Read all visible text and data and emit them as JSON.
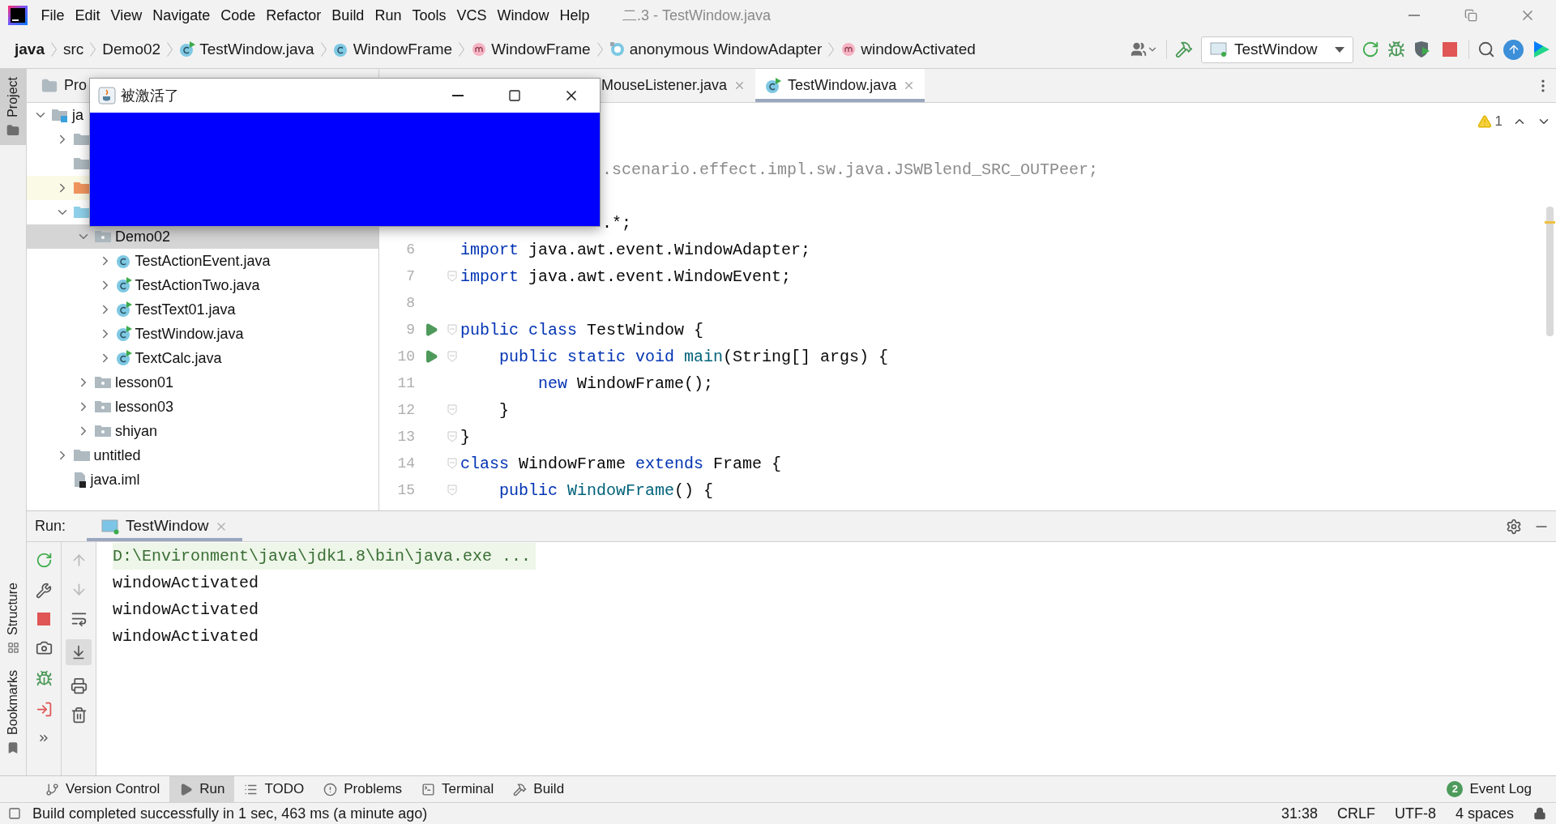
{
  "window": {
    "title": "二.3 - TestWindow.java"
  },
  "menu": [
    "File",
    "Edit",
    "View",
    "Navigate",
    "Code",
    "Refactor",
    "Build",
    "Run",
    "Tools",
    "VCS",
    "Window",
    "Help"
  ],
  "breadcrumbs": [
    {
      "label": "java",
      "kind": "module"
    },
    {
      "label": "src",
      "kind": "plain"
    },
    {
      "label": "Demo02",
      "kind": "plain"
    },
    {
      "label": "TestWindow.java",
      "kind": "runnable-class"
    },
    {
      "label": "WindowFrame",
      "kind": "class"
    },
    {
      "label": "WindowFrame",
      "kind": "method"
    },
    {
      "label": "anonymous WindowAdapter",
      "kind": "anonymous"
    },
    {
      "label": "windowActivated",
      "kind": "method"
    }
  ],
  "run_config": {
    "label": "TestWindow"
  },
  "popup": {
    "title": "被激活了"
  },
  "side_tabs": [
    {
      "label": "Project",
      "selected": true,
      "kind": "project"
    },
    {
      "label": "Structure",
      "selected": false,
      "kind": "structure"
    },
    {
      "label": "Bookmarks",
      "selected": false,
      "kind": "bookmarks"
    }
  ],
  "project_panel": {
    "title": "Pro",
    "tree": [
      {
        "label": "ja",
        "kind": "module",
        "expanded": true,
        "selected": false,
        "children": [
          {
            "kind": "folder",
            "expanded": false,
            "selected": false
          },
          {
            "kind": "folder",
            "selected": false
          },
          {
            "kind": "excluded",
            "expanded": false,
            "selected": false
          },
          {
            "kind": "source",
            "expanded": true,
            "selected": false,
            "children": [
              {
                "label": "Demo02",
                "kind": "package",
                "expanded": true,
                "selected": true,
                "children": [
                  {
                    "label": "TestActionEvent.java",
                    "kind": "class",
                    "expanded": false,
                    "selected": false
                  },
                  {
                    "label": "TestActionTwo.java",
                    "kind": "runnable-class",
                    "expanded": false,
                    "selected": false
                  },
                  {
                    "label": "TestText01.java",
                    "kind": "runnable-class",
                    "expanded": false,
                    "selected": false
                  },
                  {
                    "label": "TestWindow.java",
                    "kind": "runnable-class",
                    "expanded": false,
                    "selected": false
                  },
                  {
                    "label": "TextCalc.java",
                    "kind": "runnable-class",
                    "expanded": false,
                    "selected": false
                  }
                ]
              },
              {
                "label": "lesson01",
                "kind": "package",
                "expanded": false,
                "selected": false
              },
              {
                "label": "lesson03",
                "kind": "package",
                "expanded": false,
                "selected": false
              },
              {
                "label": "shiyan",
                "kind": "package",
                "expanded": false,
                "selected": false
              }
            ]
          },
          {
            "label": "untitled",
            "kind": "folder",
            "expanded": false,
            "selected": false
          },
          {
            "label": "java.iml",
            "kind": "file",
            "selected": false
          }
        ]
      }
    ]
  },
  "editor": {
    "tabs": [
      {
        "label": "MouseListener.java",
        "selected": false
      },
      {
        "label": "TestWindow.java",
        "selected": true
      }
    ],
    "warnings": "1",
    "lines": [
      {
        "kind": "partial",
        "tokens": [
          {
            "kind": "unused",
            "text": ".scenario.effect.impl.sw.java.JSWBlend_SRC_OUTPeer;"
          }
        ]
      },
      {
        "kind": "blank"
      },
      {
        "kind": "partial",
        "tokens": [
          {
            "kind": "plain",
            "text": ".*;"
          }
        ]
      },
      {
        "kind": "code",
        "number": "6",
        "run": false,
        "fold": false,
        "tokens": [
          {
            "kind": "keyword",
            "text": "import"
          },
          {
            "kind": "plain",
            "text": " java.awt.event.WindowAdapter;"
          }
        ]
      },
      {
        "kind": "code",
        "number": "7",
        "run": false,
        "fold": true,
        "tokens": [
          {
            "kind": "keyword",
            "text": "import"
          },
          {
            "kind": "plain",
            "text": " java.awt.event.WindowEvent;"
          }
        ]
      },
      {
        "kind": "code",
        "number": "8",
        "run": false,
        "fold": false
      },
      {
        "kind": "code",
        "number": "9",
        "run": true,
        "fold": true,
        "tokens": [
          {
            "kind": "keyword",
            "text": "public class"
          },
          {
            "kind": "plain",
            "text": " TestWindow {"
          }
        ]
      },
      {
        "kind": "code",
        "number": "10",
        "run": true,
        "fold": true,
        "tokens": [
          {
            "kind": "keyword",
            "text": "    public static void"
          },
          {
            "kind": "method",
            "text": " main"
          },
          {
            "kind": "plain",
            "text": "(String[] args) {"
          }
        ]
      },
      {
        "kind": "code",
        "number": "11",
        "run": false,
        "fold": false,
        "tokens": [
          {
            "kind": "keyword",
            "text": "        new"
          },
          {
            "kind": "plain",
            "text": " WindowFrame();"
          }
        ]
      },
      {
        "kind": "code",
        "number": "12",
        "run": false,
        "fold": true,
        "tokens": [
          {
            "kind": "plain",
            "text": "    }"
          }
        ]
      },
      {
        "kind": "code",
        "number": "13",
        "run": false,
        "fold": true,
        "tokens": [
          {
            "kind": "plain",
            "text": "}"
          }
        ]
      },
      {
        "kind": "code",
        "number": "14",
        "run": false,
        "fold": true,
        "tokens": [
          {
            "kind": "keyword",
            "text": "class"
          },
          {
            "kind": "plain",
            "text": " WindowFrame "
          },
          {
            "kind": "keyword",
            "text": "extends"
          },
          {
            "kind": "plain",
            "text": " Frame {"
          }
        ]
      },
      {
        "kind": "code",
        "number": "15",
        "run": false,
        "fold": true,
        "tokens": [
          {
            "kind": "keyword",
            "text": "    public"
          },
          {
            "kind": "method",
            "text": " WindowFrame"
          },
          {
            "kind": "plain",
            "text": "() {"
          }
        ]
      }
    ]
  },
  "run_panel": {
    "label": "Run:",
    "tabs": [
      {
        "label": "TestWindow",
        "selected": true
      }
    ],
    "console": [
      {
        "kind": "command",
        "text": "D:\\Environment\\java\\jdk1.8\\bin\\java.exe ..."
      },
      {
        "kind": "output",
        "text": "windowActivated"
      },
      {
        "kind": "output",
        "text": "windowActivated"
      },
      {
        "kind": "output",
        "text": "windowActivated"
      }
    ]
  },
  "tool_windows": [
    {
      "label": "Version Control",
      "kind": "vcs",
      "selected": false
    },
    {
      "label": "Run",
      "kind": "run",
      "selected": true
    },
    {
      "label": "TODO",
      "kind": "todo",
      "selected": false
    },
    {
      "label": "Problems",
      "kind": "problems",
      "selected": false
    },
    {
      "label": "Terminal",
      "kind": "terminal",
      "selected": false
    },
    {
      "label": "Build",
      "kind": "build",
      "selected": false
    }
  ],
  "event_log": {
    "count": "2",
    "label": "Event Log"
  },
  "status_bar": {
    "message": "Build completed successfully in 1 sec, 463 ms (a minute ago)",
    "items": [
      "31:38",
      "CRLF",
      "UTF-8",
      "4 spaces"
    ]
  }
}
